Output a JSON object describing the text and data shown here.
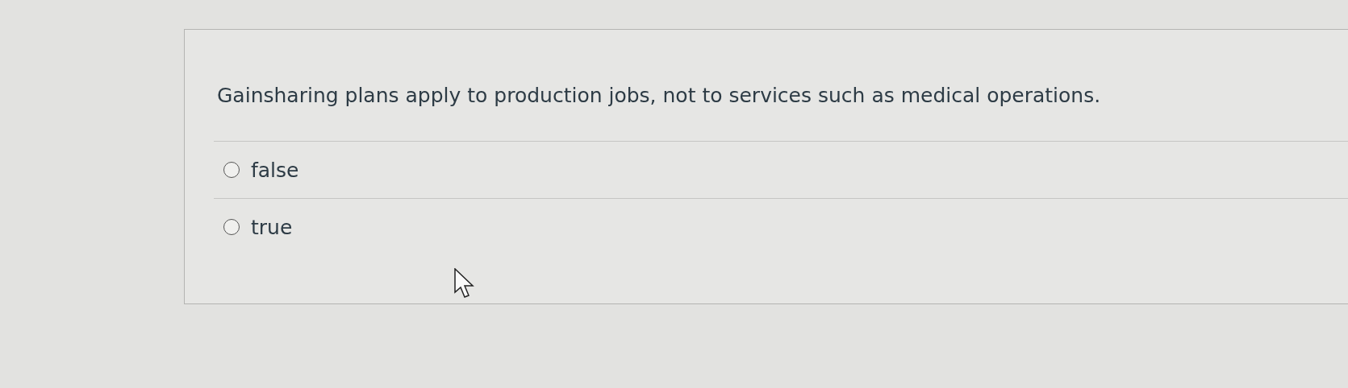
{
  "question": {
    "text": "Gainsharing plans apply to production jobs, not to services such as medical operations.",
    "options": [
      {
        "label": "false",
        "selected": false
      },
      {
        "label": "true",
        "selected": false
      }
    ]
  }
}
